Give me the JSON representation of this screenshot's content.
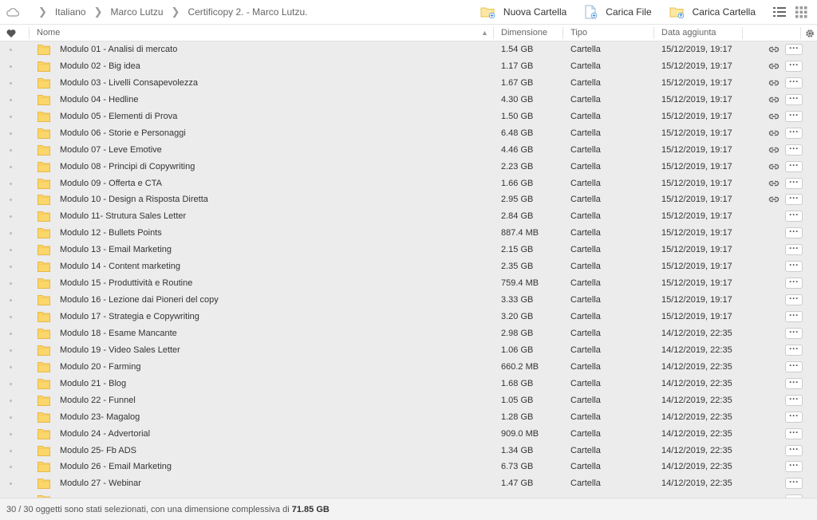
{
  "breadcrumb": {
    "items": [
      "Italiano",
      "Marco Lutzu",
      "Certificopy 2. - Marco Lutzu."
    ]
  },
  "toolbar": {
    "new_folder_label": "Nuova Cartella",
    "upload_file_label": "Carica File",
    "upload_folder_label": "Carica Cartella"
  },
  "columns": {
    "name": "Nome",
    "size": "Dimensione",
    "type": "Tipo",
    "date": "Data aggiunta"
  },
  "colors": {
    "folder": "#fbd66a",
    "row_bg": "#ececec",
    "accent": "#f2b632"
  },
  "rows": [
    {
      "name": "Modulo 01 - Analisi di mercato",
      "size": "1.54 GB",
      "type": "Cartella",
      "date": "15/12/2019, 19:17",
      "link": true
    },
    {
      "name": "Modulo 02 - Big idea",
      "size": "1.17 GB",
      "type": "Cartella",
      "date": "15/12/2019, 19:17",
      "link": true
    },
    {
      "name": "Modulo 03 - Livelli Consapevolezza",
      "size": "1.67 GB",
      "type": "Cartella",
      "date": "15/12/2019, 19:17",
      "link": true
    },
    {
      "name": "Modulo 04 - Hedline",
      "size": "4.30 GB",
      "type": "Cartella",
      "date": "15/12/2019, 19:17",
      "link": true
    },
    {
      "name": "Modulo 05 - Elementi di Prova",
      "size": "1.50 GB",
      "type": "Cartella",
      "date": "15/12/2019, 19:17",
      "link": true
    },
    {
      "name": "Modulo 06 - Storie e Personaggi",
      "size": "6.48 GB",
      "type": "Cartella",
      "date": "15/12/2019, 19:17",
      "link": true
    },
    {
      "name": "Modulo 07 - Leve Emotive",
      "size": "4.46 GB",
      "type": "Cartella",
      "date": "15/12/2019, 19:17",
      "link": true
    },
    {
      "name": "Modulo 08 - Principi di Copywriting",
      "size": "2.23 GB",
      "type": "Cartella",
      "date": "15/12/2019, 19:17",
      "link": true
    },
    {
      "name": "Modulo 09 - Offerta e CTA",
      "size": "1.66 GB",
      "type": "Cartella",
      "date": "15/12/2019, 19:17",
      "link": true
    },
    {
      "name": "Modulo 10 - Design a Risposta Diretta",
      "size": "2.95 GB",
      "type": "Cartella",
      "date": "15/12/2019, 19:17",
      "link": true
    },
    {
      "name": "Modulo 11- Strutura Sales Letter",
      "size": "2.84 GB",
      "type": "Cartella",
      "date": "15/12/2019, 19:17",
      "link": false
    },
    {
      "name": "Modulo 12 - Bullets Points",
      "size": "887.4 MB",
      "type": "Cartella",
      "date": "15/12/2019, 19:17",
      "link": false
    },
    {
      "name": "Modulo 13 - Email Marketing",
      "size": "2.15 GB",
      "type": "Cartella",
      "date": "15/12/2019, 19:17",
      "link": false
    },
    {
      "name": "Modulo 14 - Content marketing",
      "size": "2.35 GB",
      "type": "Cartella",
      "date": "15/12/2019, 19:17",
      "link": false
    },
    {
      "name": "Modulo 15 - Produttività e Routine",
      "size": "759.4 MB",
      "type": "Cartella",
      "date": "15/12/2019, 19:17",
      "link": false
    },
    {
      "name": "Modulo 16 - Lezione dai Pioneri del copy",
      "size": "3.33 GB",
      "type": "Cartella",
      "date": "15/12/2019, 19:17",
      "link": false
    },
    {
      "name": "Modulo 17 - Strategia e Copywriting",
      "size": "3.20 GB",
      "type": "Cartella",
      "date": "15/12/2019, 19:17",
      "link": false
    },
    {
      "name": "Modulo 18 - Esame Mancante",
      "size": "2.98 GB",
      "type": "Cartella",
      "date": "14/12/2019, 22:35",
      "link": false
    },
    {
      "name": "Modulo 19 - Video Sales Letter",
      "size": "1.06 GB",
      "type": "Cartella",
      "date": "14/12/2019, 22:35",
      "link": false
    },
    {
      "name": "Modulo 20 - Farming",
      "size": "660.2 MB",
      "type": "Cartella",
      "date": "14/12/2019, 22:35",
      "link": false
    },
    {
      "name": "Modulo 21 - Blog",
      "size": "1.68 GB",
      "type": "Cartella",
      "date": "14/12/2019, 22:35",
      "link": false
    },
    {
      "name": "Modulo 22 - Funnel",
      "size": "1.05 GB",
      "type": "Cartella",
      "date": "14/12/2019, 22:35",
      "link": false
    },
    {
      "name": "Modulo 23- Magalog",
      "size": "1.28 GB",
      "type": "Cartella",
      "date": "14/12/2019, 22:35",
      "link": false
    },
    {
      "name": "Modulo 24 - Advertorial",
      "size": "909.0 MB",
      "type": "Cartella",
      "date": "14/12/2019, 22:35",
      "link": false
    },
    {
      "name": "Modulo 25- Fb ADS",
      "size": "1.34 GB",
      "type": "Cartella",
      "date": "14/12/2019, 22:35",
      "link": false
    },
    {
      "name": "Modulo 26 - Email Marketing",
      "size": "6.73 GB",
      "type": "Cartella",
      "date": "14/12/2019, 22:35",
      "link": false
    },
    {
      "name": "Modulo 27 - Webinar",
      "size": "1.47 GB",
      "type": "Cartella",
      "date": "14/12/2019, 22:35",
      "link": false
    }
  ],
  "footer": {
    "prefix": "30 / 30 oggetti sono stati selezionati, con una dimensione complessiva di",
    "total": "71.85 GB"
  }
}
